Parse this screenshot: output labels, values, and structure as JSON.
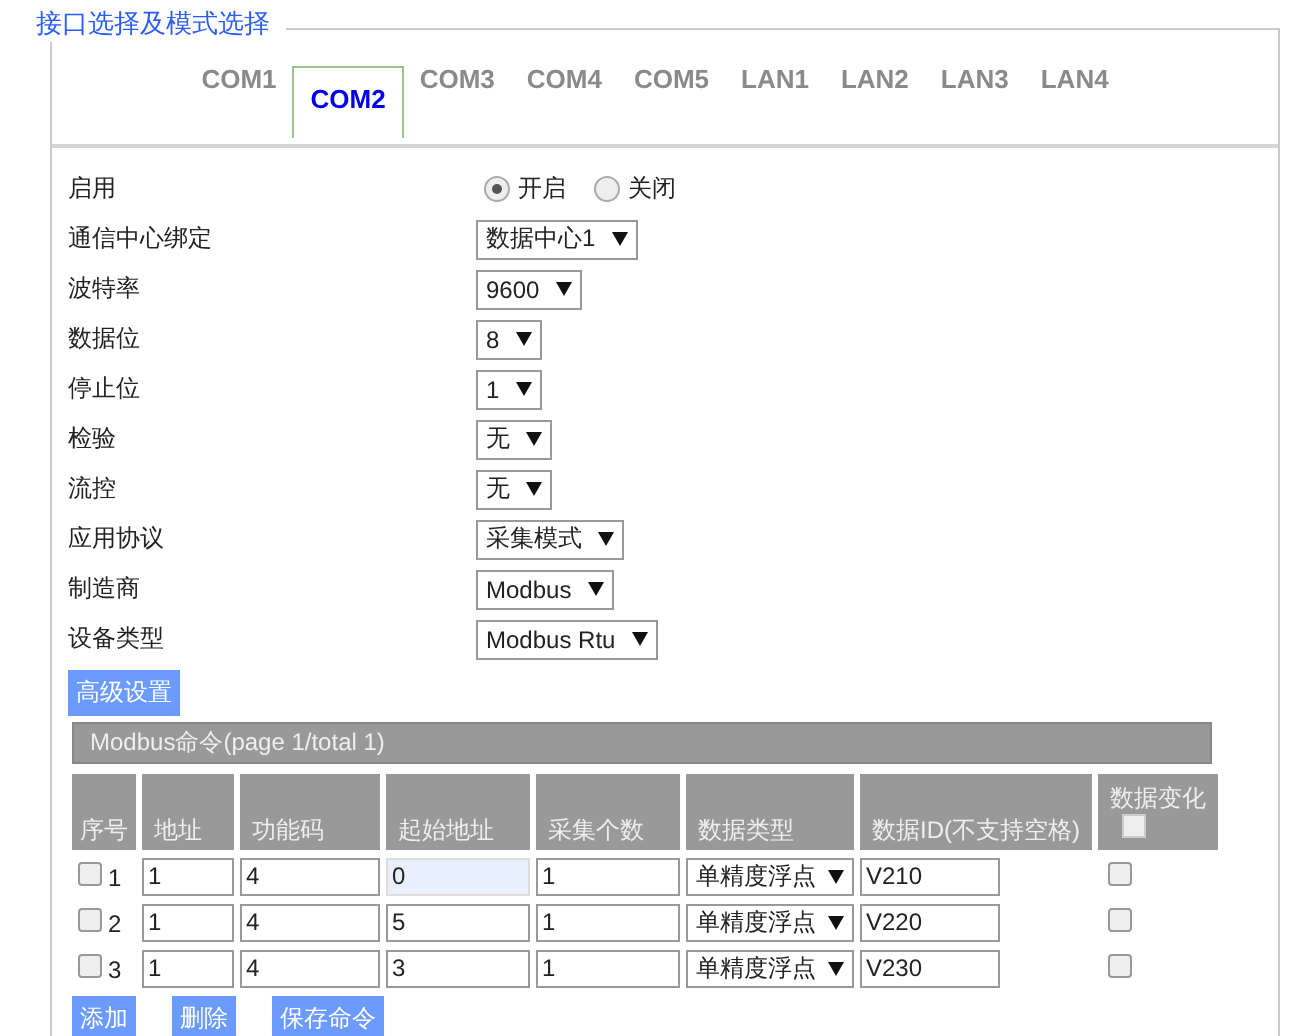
{
  "legend": "接口选择及模式选择",
  "tabs": [
    {
      "label": "COM1",
      "selected": false
    },
    {
      "label": "COM2",
      "selected": true
    },
    {
      "label": "COM3",
      "selected": false
    },
    {
      "label": "COM4",
      "selected": false
    },
    {
      "label": "COM5",
      "selected": false
    },
    {
      "label": "LAN1",
      "selected": false
    },
    {
      "label": "LAN2",
      "selected": false
    },
    {
      "label": "LAN3",
      "selected": false
    },
    {
      "label": "LAN4",
      "selected": false
    }
  ],
  "fields": [
    {
      "kind": "radio",
      "label": "启用",
      "options": [
        {
          "label": "开启",
          "selected": true
        },
        {
          "label": "关闭",
          "selected": false
        }
      ]
    },
    {
      "kind": "select",
      "label": "通信中心绑定",
      "value": "数据中心1"
    },
    {
      "kind": "select",
      "label": "波特率",
      "value": "9600"
    },
    {
      "kind": "select",
      "label": "数据位",
      "value": "8"
    },
    {
      "kind": "select",
      "label": "停止位",
      "value": "1"
    },
    {
      "kind": "select",
      "label": "检验",
      "value": "无"
    },
    {
      "kind": "select",
      "label": "流控",
      "value": "无"
    },
    {
      "kind": "select",
      "label": "应用协议",
      "value": "采集模式"
    },
    {
      "kind": "select",
      "label": "制造商",
      "value": "Modbus"
    },
    {
      "kind": "select",
      "label": "设备类型",
      "value": "Modbus Rtu"
    }
  ],
  "advanced_button": "高级设置",
  "table": {
    "title": "Modbus命令(page 1/total 1)",
    "columns": [
      "序号",
      "地址",
      "功能码",
      "起始地址",
      "采集个数",
      "数据类型",
      "数据ID(不支持空格)",
      "数据变化"
    ],
    "change_all_checked": false,
    "rows": [
      {
        "checked": false,
        "index": "1",
        "address": "1",
        "function": "4",
        "start": "0",
        "start_focused": true,
        "count": "1",
        "type": "单精度浮点",
        "data_id": "V210",
        "change": false
      },
      {
        "checked": false,
        "index": "2",
        "address": "1",
        "function": "4",
        "start": "5",
        "start_focused": false,
        "count": "1",
        "type": "单精度浮点",
        "data_id": "V220",
        "change": false
      },
      {
        "checked": false,
        "index": "3",
        "address": "1",
        "function": "4",
        "start": "3",
        "start_focused": false,
        "count": "1",
        "type": "单精度浮点",
        "data_id": "V230",
        "change": false
      }
    ]
  },
  "buttons": [
    "添加",
    "删除",
    "保存命令"
  ]
}
